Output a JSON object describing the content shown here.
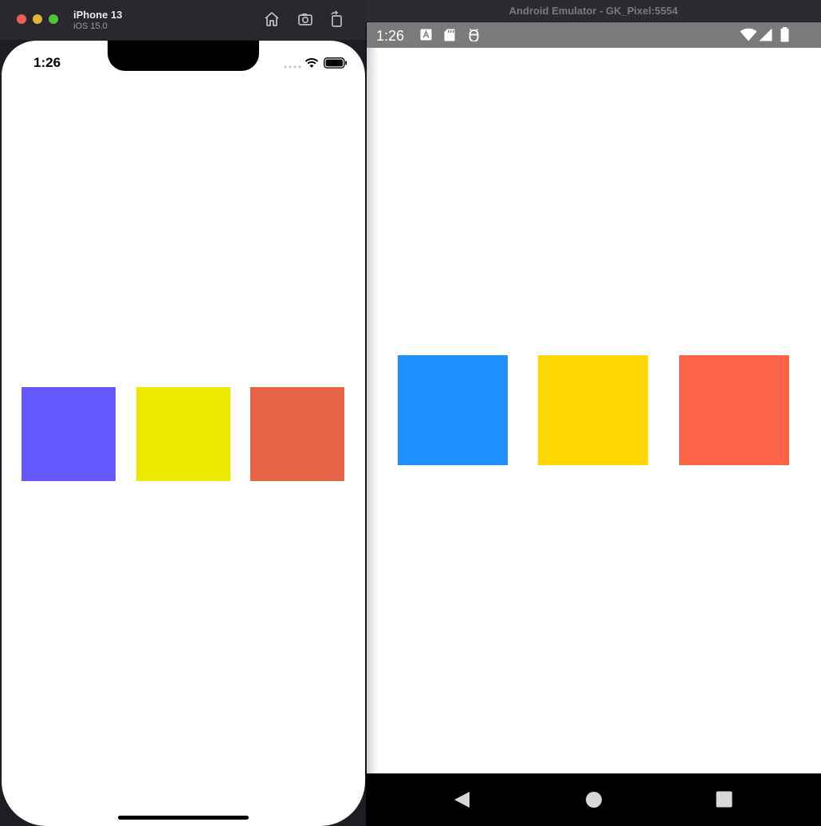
{
  "ios": {
    "titlebar": {
      "device_name": "iPhone 13",
      "os_version": "iOS 15.0",
      "icons": [
        "home-icon",
        "screenshot-icon",
        "rotate-icon"
      ]
    },
    "status": {
      "time": "1:26"
    },
    "boxes": [
      {
        "color": "#6557ff"
      },
      {
        "color": "#ece800"
      },
      {
        "color": "#e66346"
      }
    ]
  },
  "android": {
    "window_title": "Android Emulator - GK_Pixel:5554",
    "status": {
      "time": "1:26"
    },
    "status_icons": [
      "app-notification-icon",
      "sd-card-icon",
      "android-debug-icon",
      "wifi-icon",
      "signal-icon",
      "battery-icon"
    ],
    "boxes": [
      {
        "color": "#1e90ff"
      },
      {
        "color": "#ffd700"
      },
      {
        "color": "#ff6347"
      }
    ],
    "navigation": [
      "back-icon",
      "home-icon",
      "recents-icon"
    ]
  }
}
